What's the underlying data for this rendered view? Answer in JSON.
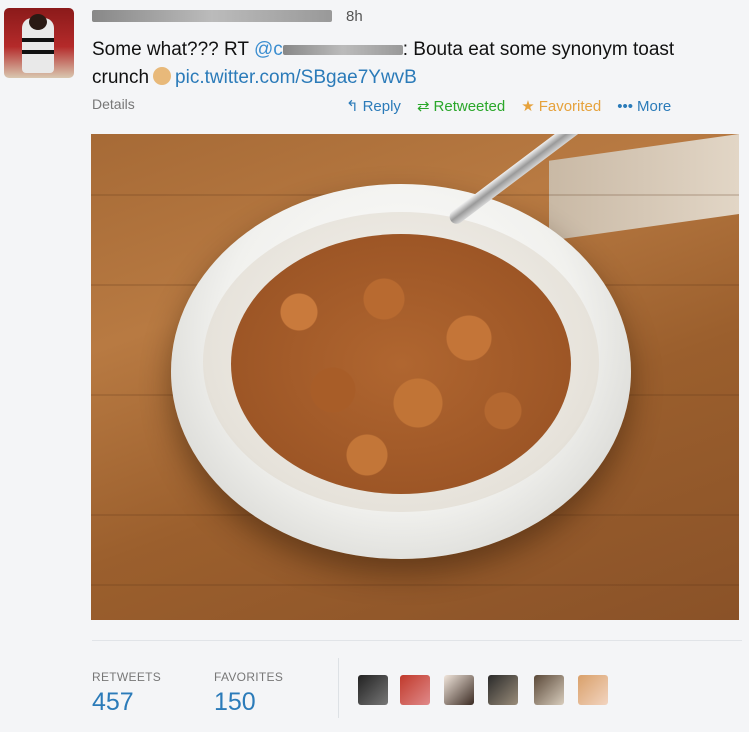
{
  "tweet": {
    "time": "8h",
    "text_prefix": "Some what??? RT ",
    "mention_visible": "@c",
    "text_after_mention": ": Bouta eat some synonym toast",
    "text_line2": "crunch",
    "link": "pic.twitter.com/SBgae7YwvB"
  },
  "meta": {
    "details_label": "Details"
  },
  "actions": {
    "reply": "Reply",
    "retweeted": "Retweeted",
    "favorited": "Favorited",
    "more": "More"
  },
  "stats": {
    "retweets_label": "RETWEETS",
    "retweets_value": "457",
    "favorites_label": "FAVORITES",
    "favorites_value": "150"
  },
  "icons": {
    "reply": "reply-arrow-icon",
    "retweet": "retweet-icon",
    "favorite": "star-icon",
    "more": "ellipsis-icon"
  },
  "colors": {
    "link": "#2b7bb9",
    "retweet": "#2aa72a",
    "favorite": "#e6a23c"
  }
}
